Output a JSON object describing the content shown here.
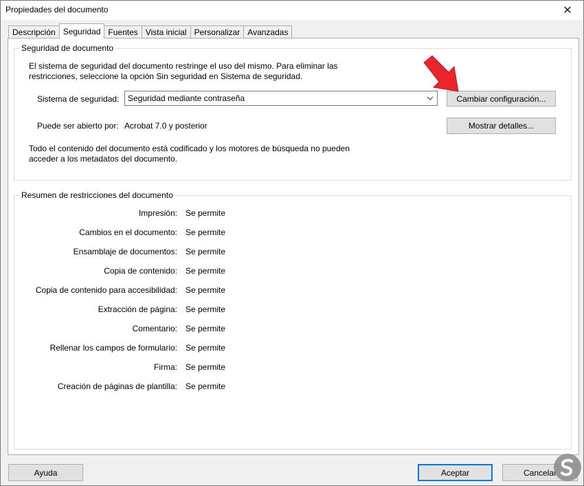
{
  "window": {
    "title": "Propiedades del documento",
    "close_glyph": "✕"
  },
  "tabs": [
    {
      "label": "Descripción",
      "active": false
    },
    {
      "label": "Seguridad",
      "active": true
    },
    {
      "label": "Fuentes",
      "active": false
    },
    {
      "label": "Vista inicial",
      "active": false
    },
    {
      "label": "Personalizar",
      "active": false
    },
    {
      "label": "Avanzadas",
      "active": false
    }
  ],
  "security_group": {
    "title": "Seguridad de documento",
    "description_line1": "El sistema de seguridad del documento restringe el uso del mismo. Para eliminar las",
    "description_line2": "restricciones, seleccione la opción Sin seguridad en Sistema de seguridad.",
    "system_label": "Sistema de seguridad:",
    "system_value": "Seguridad mediante contraseña",
    "change_button": "Cambiar configuración...",
    "opened_by_label": "Puede ser abierto por:",
    "opened_by_value": "Acrobat 7.0 y posterior",
    "details_button": "Mostrar detalles...",
    "note_line1": "Todo el contenido del documento está codificado y los motores de búsqueda no pueden",
    "note_line2": "acceder a los metadatos del documento."
  },
  "restrictions_group": {
    "title": "Resumen de restricciones del documento",
    "rows": [
      {
        "label": "Impresión:",
        "value": "Se permite"
      },
      {
        "label": "Cambios en el documento:",
        "value": "Se permite"
      },
      {
        "label": "Ensamblaje de documentos:",
        "value": "Se permite"
      },
      {
        "label": "Copia de contenido:",
        "value": "Se permite"
      },
      {
        "label": "Copia de contenido para accesibilidad:",
        "value": "Se permite"
      },
      {
        "label": "Extracción de página:",
        "value": "Se permite"
      },
      {
        "label": "Comentario:",
        "value": "Se permite"
      },
      {
        "label": "Rellenar los campos de formulario:",
        "value": "Se permite"
      },
      {
        "label": "Firma:",
        "value": "Se permite"
      },
      {
        "label": "Creación de páginas de plantilla:",
        "value": "Se permite"
      }
    ]
  },
  "footer": {
    "help_button": "Ayuda",
    "accept_button": "Aceptar",
    "cancel_button": "Cancelar"
  },
  "colors": {
    "annotation_arrow": "#e8262b",
    "default_button_border": "#0078d7",
    "logo": "#8a8a8a"
  },
  "icons": {
    "close": "close-icon",
    "dropdown": "chevron-down-icon",
    "annotation": "arrow-annotation-icon",
    "watermark": "logo-icon"
  }
}
